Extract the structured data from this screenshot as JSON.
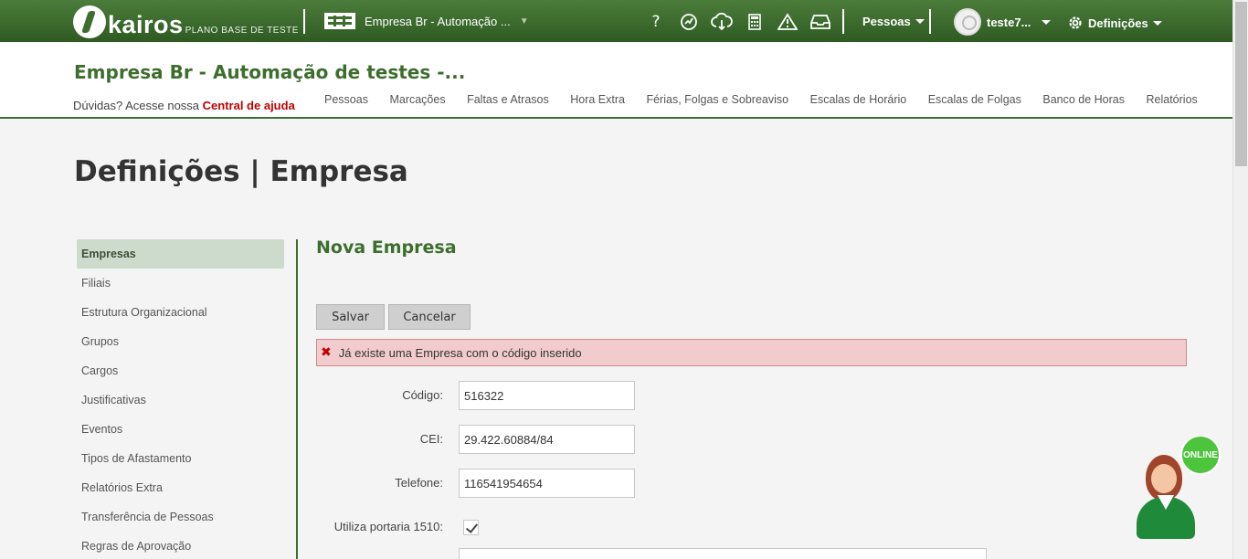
{
  "topbar": {
    "logo_text": "kairos",
    "logo_sub": "PLANO BASE DE TESTE",
    "company_selector": "Empresa Br - Automação ...",
    "icons": [
      "help-icon",
      "support-icon",
      "cloud-download-icon",
      "calculator-icon",
      "warning-icon",
      "inbox-icon"
    ],
    "help_glyph": "?",
    "pessoas_label": "Pessoas",
    "user_label": "teste7...",
    "definicoes_label": "Definições"
  },
  "header": {
    "company_title": "Empresa Br - Automação de testes -...",
    "help_prefix": "Dúvidas? Acesse nossa",
    "help_link": "Central de ajuda",
    "nav": [
      "Pessoas",
      "Marcações",
      "Faltas e Atrasos",
      "Hora Extra",
      "Férias, Folgas e Sobreaviso",
      "Escalas de Horário",
      "Escalas de Folgas",
      "Banco de Horas",
      "Relatórios"
    ]
  },
  "page_title": "Definições | Empresa",
  "sidebar": {
    "items": [
      "Empresas",
      "Filiais",
      "Estrutura Organizacional",
      "Grupos",
      "Cargos",
      "Justificativas",
      "Eventos",
      "Tipos de Afastamento",
      "Relatórios Extra",
      "Transferência de Pessoas",
      "Regras de Aprovação"
    ],
    "active_index": 0
  },
  "form": {
    "title": "Nova Empresa",
    "save_label": "Salvar",
    "cancel_label": "Cancelar",
    "error_message": "Já existe uma Empresa com o código inserido",
    "codigo_label": "Código:",
    "codigo_value": "516322",
    "cei_label": "CEI:",
    "cei_value": "29.422.60884/84",
    "telefone_label": "Telefone:",
    "telefone_value": "116541954654",
    "portaria_label": "Utiliza portaria 1510:",
    "portaria_checked": true
  },
  "widget": {
    "online_label": "ONLINE"
  },
  "colors": {
    "brand_green": "#3d6e2e",
    "error_bg": "#f2cccc",
    "link_red": "#c00000"
  }
}
